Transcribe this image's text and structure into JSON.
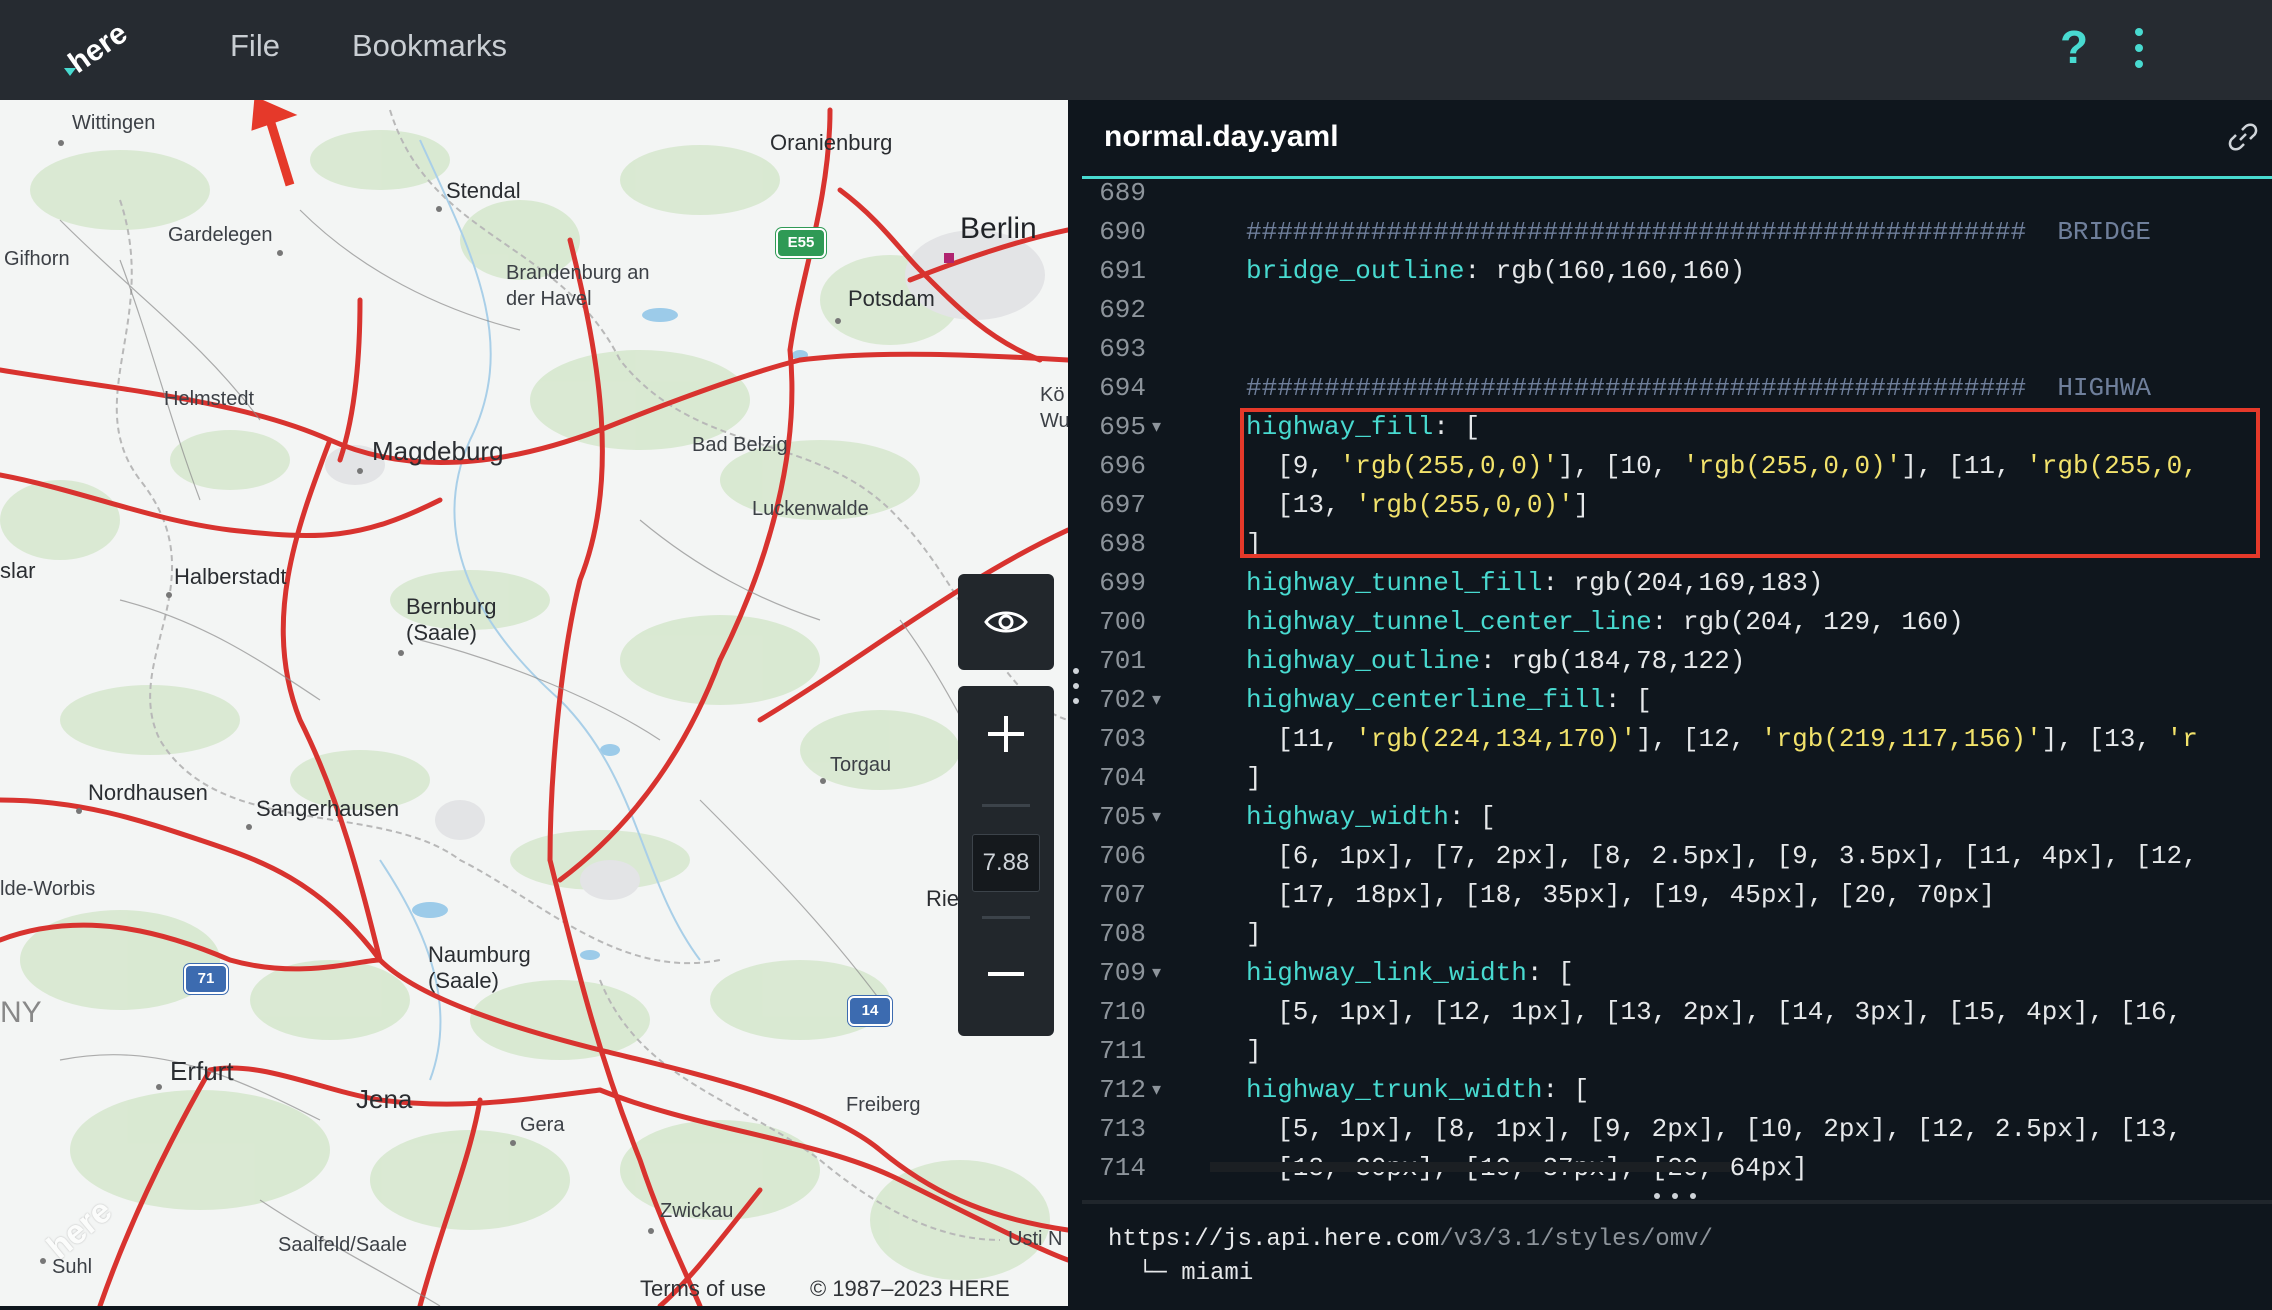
{
  "header": {
    "logo_text": "here",
    "menu": [
      "File",
      "Bookmarks"
    ],
    "help_icon": "?",
    "more_icon": "more-vertical-icon"
  },
  "map": {
    "places": [
      {
        "id": "wittingen",
        "label": "Wittingen"
      },
      {
        "id": "oranienburg",
        "label": "Oranienburg"
      },
      {
        "id": "stendal",
        "label": "Stendal"
      },
      {
        "id": "berlin",
        "label": "Berlin"
      },
      {
        "id": "gardelegen",
        "label": "Gardelegen"
      },
      {
        "id": "gifhorn",
        "label": "Gifhorn"
      },
      {
        "id": "brandenburg",
        "label": "Brandenburg an\nder Havel"
      },
      {
        "id": "potsdam",
        "label": "Potsdam"
      },
      {
        "id": "helmstedt",
        "label": "Helmstedt"
      },
      {
        "id": "ko",
        "label": "Kö"
      },
      {
        "id": "wu",
        "label": "Wu"
      },
      {
        "id": "magdeburg",
        "label": "Magdeburg"
      },
      {
        "id": "badbelzig",
        "label": "Bad Belzig"
      },
      {
        "id": "luckenwalde",
        "label": "Luckenwalde"
      },
      {
        "id": "slar",
        "label": "slar"
      },
      {
        "id": "halberstadt",
        "label": "Halberstadt"
      },
      {
        "id": "bernburg",
        "label": "Bernburg\n(Saale)"
      },
      {
        "id": "torgau",
        "label": "Torgau"
      },
      {
        "id": "nordhausen",
        "label": "Nordhausen"
      },
      {
        "id": "sangerhausen",
        "label": "Sangerhausen"
      },
      {
        "id": "worbis",
        "label": "lde-Worbis"
      },
      {
        "id": "rie",
        "label": "Rie"
      },
      {
        "id": "naumburg",
        "label": "Naumburg\n(Saale)"
      },
      {
        "id": "ny",
        "label": "NY"
      },
      {
        "id": "erfurt",
        "label": "Erfurt"
      },
      {
        "id": "jena",
        "label": "Jena"
      },
      {
        "id": "gera",
        "label": "Gera"
      },
      {
        "id": "freiberg",
        "label": "Freiberg"
      },
      {
        "id": "zwickau",
        "label": "Zwickau"
      },
      {
        "id": "saalfeld",
        "label": "Saalfeld/Saale"
      },
      {
        "id": "suhl",
        "label": "Suhl"
      },
      {
        "id": "usti",
        "label": "Usti N"
      }
    ],
    "shields": [
      {
        "id": "e55",
        "label": "E55",
        "color": "#2f9a55"
      },
      {
        "id": "a71",
        "label": "71",
        "color": "#3c6bb0"
      },
      {
        "id": "a14",
        "label": "14",
        "color": "#3c6bb0"
      }
    ],
    "zoom_level": "7.88",
    "terms": "Terms of use",
    "copyright": "© 1987–2023 HERE",
    "watermark": "here"
  },
  "editor": {
    "filename": "normal.day.yaml",
    "lines": [
      {
        "n": "689",
        "fold": "",
        "html": ""
      },
      {
        "n": "690",
        "fold": "",
        "html": "<span class='c'>##################################################  BRIDGE</span>"
      },
      {
        "n": "691",
        "fold": "",
        "html": "<span class='k'>bridge_outline</span>: rgb(160,160,160)"
      },
      {
        "n": "692",
        "fold": "",
        "html": ""
      },
      {
        "n": "693",
        "fold": "",
        "html": ""
      },
      {
        "n": "694",
        "fold": "",
        "html": "<span class='c'>##################################################  HIGHWA</span>"
      },
      {
        "n": "695",
        "fold": "▾",
        "html": "<span class='k'>highway_fill</span>: ["
      },
      {
        "n": "696",
        "fold": "",
        "html": "  [9, <span class='s'>'rgb(255,0,0)'</span>], [10, <span class='s'>'rgb(255,0,0)'</span>], [11, <span class='s'>'rgb(255,0,</span>"
      },
      {
        "n": "697",
        "fold": "",
        "html": "  [13, <span class='s'>'rgb(255,0,0)'</span>]"
      },
      {
        "n": "698",
        "fold": "",
        "html": "]"
      },
      {
        "n": "699",
        "fold": "",
        "html": "<span class='k'>highway_tunnel_fill</span>: rgb(204,169,183)"
      },
      {
        "n": "700",
        "fold": "",
        "html": "<span class='k'>highway_tunnel_center_line</span>: rgb(204, 129, 160)"
      },
      {
        "n": "701",
        "fold": "",
        "html": "<span class='k'>highway_outline</span>: rgb(184,78,122)"
      },
      {
        "n": "702",
        "fold": "▾",
        "html": "<span class='k'>highway_centerline_fill</span>: ["
      },
      {
        "n": "703",
        "fold": "",
        "html": "  [11, <span class='s'>'rgb(224,134,170)'</span>], [12, <span class='s'>'rgb(219,117,156)'</span>], [13, <span class='s'>'r</span>"
      },
      {
        "n": "704",
        "fold": "",
        "html": "]"
      },
      {
        "n": "705",
        "fold": "▾",
        "html": "<span class='k'>highway_width</span>: ["
      },
      {
        "n": "706",
        "fold": "",
        "html": "  [6, 1px], [7, 2px], [8, 2.5px], [9, 3.5px], [11, 4px], [12,"
      },
      {
        "n": "707",
        "fold": "",
        "html": "  [17, 18px], [18, 35px], [19, 45px], [20, 70px]"
      },
      {
        "n": "708",
        "fold": "",
        "html": "]"
      },
      {
        "n": "709",
        "fold": "▾",
        "html": "<span class='k'>highway_link_width</span>: ["
      },
      {
        "n": "710",
        "fold": "",
        "html": "  [5, 1px], [12, 1px], [13, 2px], [14, 3px], [15, 4px], [16,"
      },
      {
        "n": "711",
        "fold": "",
        "html": "]"
      },
      {
        "n": "712",
        "fold": "▾",
        "html": "<span class='k'>highway_trunk_width</span>: ["
      },
      {
        "n": "713",
        "fold": "",
        "html": "  [5, 1px], [8, 1px], [9, 2px], [10, 2px], [12, 2.5px], [13,"
      },
      {
        "n": "714",
        "fold": "",
        "html": "  [18, 30px], [19, 37px], [20, 64px]"
      }
    ]
  },
  "bottom": {
    "url_host": "https://js.api.here.com",
    "url_path": "/v3/3.1/styles/omv/",
    "tree_item": "└─ miami"
  }
}
